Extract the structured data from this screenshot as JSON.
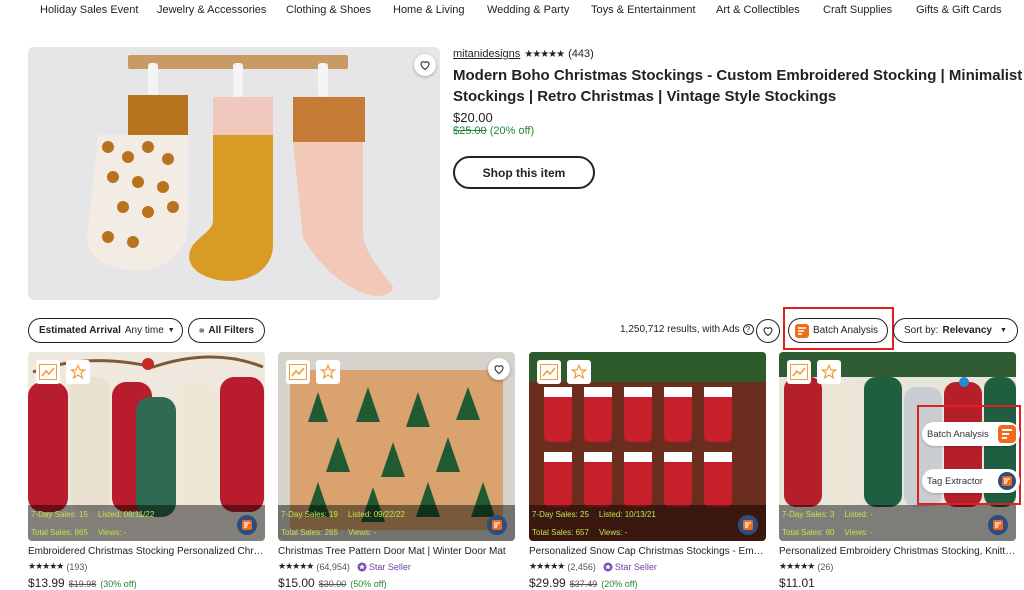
{
  "nav": {
    "items": [
      "Holiday Sales Event",
      "Jewelry & Accessories",
      "Clothing & Shoes",
      "Home & Living",
      "Wedding & Party",
      "Toys & Entertainment",
      "Art & Collectibles",
      "Craft Supplies",
      "Gifts & Gift Cards"
    ]
  },
  "featured": {
    "shop": "mitanidesigns",
    "stars": "★★★★★",
    "reviews": "(443)",
    "title": "Modern Boho Christmas Stockings - Custom Embroidered Stocking | Minimalist Stockings | Retro Christmas | Vintage Style Stockings",
    "price": "$20.00",
    "old_price": "$25.00",
    "discount": "(20% off)",
    "button": "Shop this item"
  },
  "filters": {
    "arrival_label": "Estimated Arrival",
    "arrival_value": "Any time",
    "all_filters": "All Filters",
    "results": "1,250,712 results, with Ads",
    "batch_analysis": "Batch Analysis",
    "sort_label": "Sort by:",
    "sort_value": "Relevancy"
  },
  "products": [
    {
      "sales7": "7-Day Sales: 15",
      "listed": "Listed: 08/11/22",
      "total": "Total Sales: 865",
      "views": "Views: -",
      "title": "Embroidered Christmas Stocking Personalized Christmas Stocking...",
      "stars": "★★★★★",
      "reviews": "(193)",
      "star_seller": "",
      "price": "$13.99",
      "old_price": "$19.98",
      "discount": "(30% off)"
    },
    {
      "sales7": "7-Day Sales: 19",
      "listed": "Listed: 09/22/22",
      "total": "Total Sales: 265",
      "views": "Views: -",
      "title": "Christmas Tree Pattern Door Mat | Winter Door Mat",
      "stars": "★★★★★",
      "reviews": "(64,954)",
      "star_seller": "Star Seller",
      "price": "$15.00",
      "old_price": "$30.00",
      "discount": "(50% off)"
    },
    {
      "sales7": "7-Day Sales: 25",
      "listed": "Listed: 10/13/21",
      "total": "Total Sales: 657",
      "views": "Views: -",
      "title": "Personalized Snow Cap Christmas Stockings - Embroidered",
      "stars": "★★★★★",
      "reviews": "(2,456)",
      "star_seller": "Star Seller",
      "price": "$29.99",
      "old_price": "$37.49",
      "discount": "(20% off)"
    },
    {
      "sales7": "7-Day Sales: 3",
      "listed": "Listed: -",
      "total": "Total Sales: 60",
      "views": "Views: -",
      "title": "Personalized Embroidery Christmas Stocking, Knitted Stocking",
      "stars": "★★★★★",
      "reviews": "(26)",
      "star_seller": "",
      "price": "$11.01",
      "old_price": "",
      "discount": ""
    }
  ],
  "side_panel": {
    "batch": "Batch Analysis",
    "tag": "Tag Extractor"
  }
}
